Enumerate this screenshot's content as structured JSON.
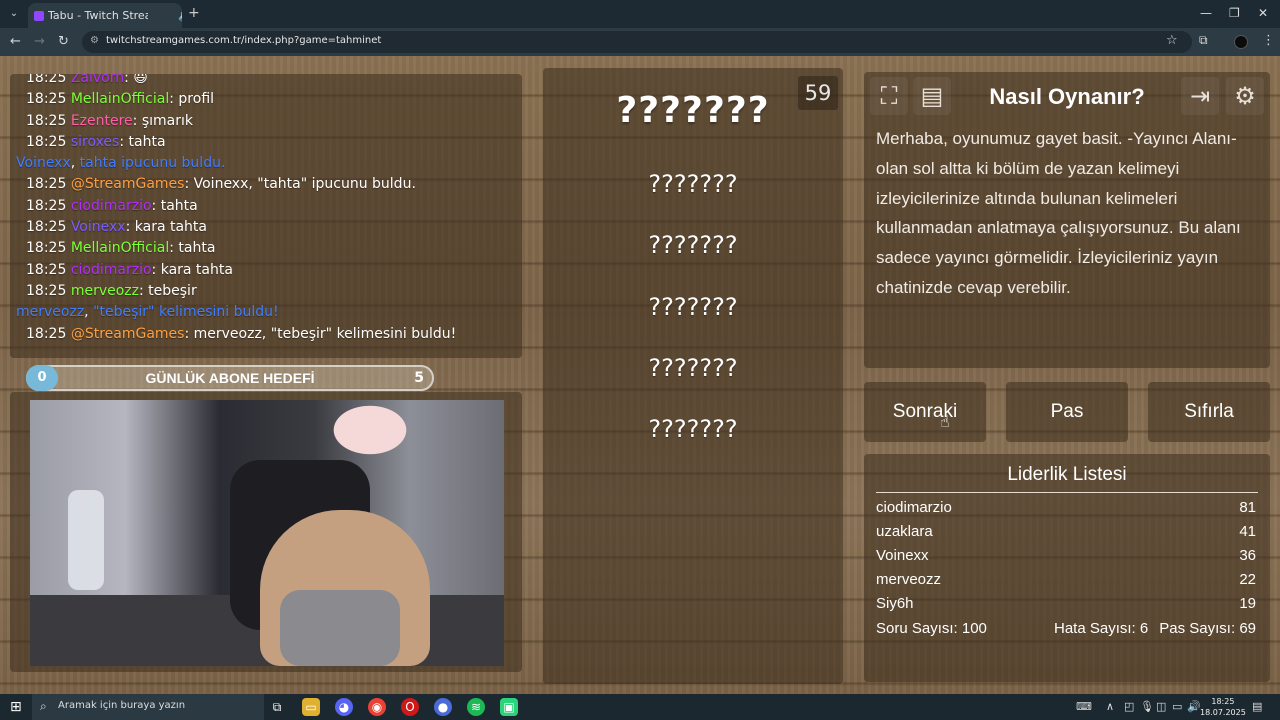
{
  "browser": {
    "tab_title": "Tabu - Twitch Stream Game",
    "url": "twitchstreamgames.com.tr/index.php?game=tahminet"
  },
  "chat": [
    {
      "time": "18:25",
      "user": "Zalvorn",
      "user_color": "#b52cff",
      "text": "😃"
    },
    {
      "time": "18:25",
      "user": "MellainOfficial",
      "user_color": "#7dff3a",
      "text": "profil"
    },
    {
      "time": "18:25",
      "user": "Ezentere",
      "user_color": "#ff5fa8",
      "text": "şımarık"
    },
    {
      "time": "18:25",
      "user": "siroxes",
      "user_color": "#7a5cff",
      "text": "tahta"
    },
    {
      "time": "",
      "user": "Voinexx",
      "user_color": "#3f7dff",
      "text": "tahta ipucunu buldu.",
      "system": true
    },
    {
      "time": "18:25",
      "user": "@StreamGames",
      "user_color": "#ff9f40",
      "text": "Voinexx, \"tahta\" ipucunu buldu."
    },
    {
      "time": "18:25",
      "user": "ciodimarzio",
      "user_color": "#b52cff",
      "text": "tahta"
    },
    {
      "time": "18:25",
      "user": "Voinexx",
      "user_color": "#7a5cff",
      "text": "kara tahta"
    },
    {
      "time": "18:25",
      "user": "MellainOfficial",
      "user_color": "#7dff3a",
      "text": "tahta"
    },
    {
      "time": "18:25",
      "user": "ciodimarzio",
      "user_color": "#b52cff",
      "text": "kara tahta"
    },
    {
      "time": "18:25",
      "user": "merveozz",
      "user_color": "#7dff3a",
      "text": "tebeşir"
    },
    {
      "time": "",
      "user": "merveozz",
      "user_color": "#3f7dff",
      "text": "\"tebeşir\" kelimesini buldu!",
      "system": true
    },
    {
      "time": "18:25",
      "user": "@StreamGames",
      "user_color": "#ff9f40",
      "text": "merveozz, \"tebeşir\" kelimesini buldu!"
    }
  ],
  "goal": {
    "start": "0",
    "label": "GÜNLÜK ABONE HEDEFİ",
    "end": "5",
    "progress": 0
  },
  "game": {
    "timer": "59",
    "main_word": "???????",
    "taboo_words": [
      "???????",
      "???????",
      "???????",
      "???????",
      "???????"
    ]
  },
  "howto": {
    "title": "Nasıl Oynanır?",
    "text": "Merhaba, oyunumuz gayet basit. -Yayıncı Alanı- olan sol altta ki bölüm de yazan kelimeyi izleyicilerinize altında bulunan kelimeleri kullanmadan anlatmaya çalışıyorsunuz. Bu alanı sadece yayıncı görmelidir. İzleyicileriniz yayın chatinizde cevap verebilir."
  },
  "buttons": {
    "next": "Sonraki",
    "pass": "Pas",
    "reset": "Sıfırla"
  },
  "leaderboard": {
    "title": "Liderlik Listesi",
    "rows": [
      {
        "name": "ciodimarzio",
        "score": "81"
      },
      {
        "name": "uzaklara",
        "score": "41"
      },
      {
        "name": "Voinexx",
        "score": "36"
      },
      {
        "name": "merveozz",
        "score": "22"
      },
      {
        "name": "Siy6h",
        "score": "19"
      }
    ],
    "question_count": "Soru Sayısı: 100",
    "error_count": "Hata Sayısı: 6",
    "pass_count": "Pas Sayısı: 69"
  },
  "taskbar": {
    "search_placeholder": "Aramak için buraya yazın",
    "time": "18:25",
    "date": "18.07.2025"
  }
}
